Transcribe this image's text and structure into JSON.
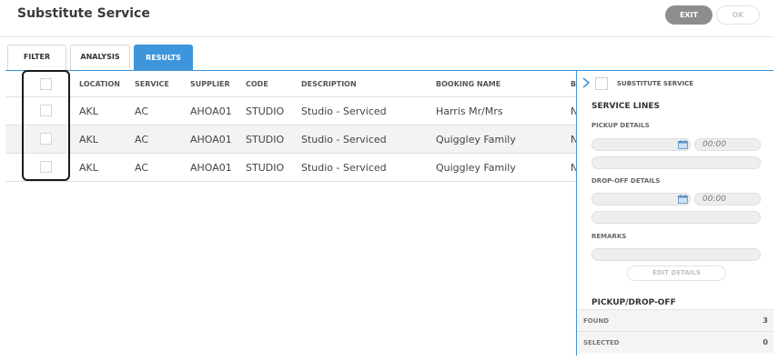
{
  "page": {
    "title": "Substitute Service"
  },
  "actions": {
    "exit_label": "EXIT",
    "ok_label": "OK"
  },
  "tabs": [
    {
      "label": "FILTER"
    },
    {
      "label": "ANALYSIS"
    },
    {
      "label": "RESULTS",
      "active": true
    }
  ],
  "grid": {
    "columns": [
      "LOCATION",
      "SERVICE",
      "SUPPLIER",
      "CODE",
      "DESCRIPTION",
      "BOOKING NAME",
      "BO"
    ],
    "rows": [
      {
        "location": "AKL",
        "service": "AC",
        "supplier": "AHOA01",
        "code": "STUDIO",
        "description": "Studio - Serviced",
        "booking_name": "Harris Mr/Mrs",
        "extra": "N"
      },
      {
        "location": "AKL",
        "service": "AC",
        "supplier": "AHOA01",
        "code": "STUDIO",
        "description": "Studio - Serviced",
        "booking_name": "Quiggley Family",
        "extra": "N"
      },
      {
        "location": "AKL",
        "service": "AC",
        "supplier": "AHOA01",
        "code": "STUDIO",
        "description": "Studio - Serviced",
        "booking_name": "Quiggley Family",
        "extra": "N"
      }
    ]
  },
  "panel": {
    "checkbox_label": "SUBSTITUTE SERVICE",
    "section_service_lines": "SERVICE LINES",
    "pickup_label": "PICKUP DETAILS",
    "pickup_time": "00:00",
    "dropoff_label": "DROP-OFF DETAILS",
    "dropoff_time": "00:00",
    "remarks_label": "REMARKS",
    "edit_details_label": "EDIT DETAILS",
    "section_pickup_dropoff": "PICKUP/DROP-OFF",
    "found_label": "FOUND",
    "found_value": "3",
    "selected_label": "SELECTED",
    "selected_value": "0"
  },
  "colors": {
    "accent": "#3d95db",
    "exit_button": "#8d8d8d"
  },
  "icons": [
    "chevron-right-icon",
    "calendar-icon"
  ]
}
